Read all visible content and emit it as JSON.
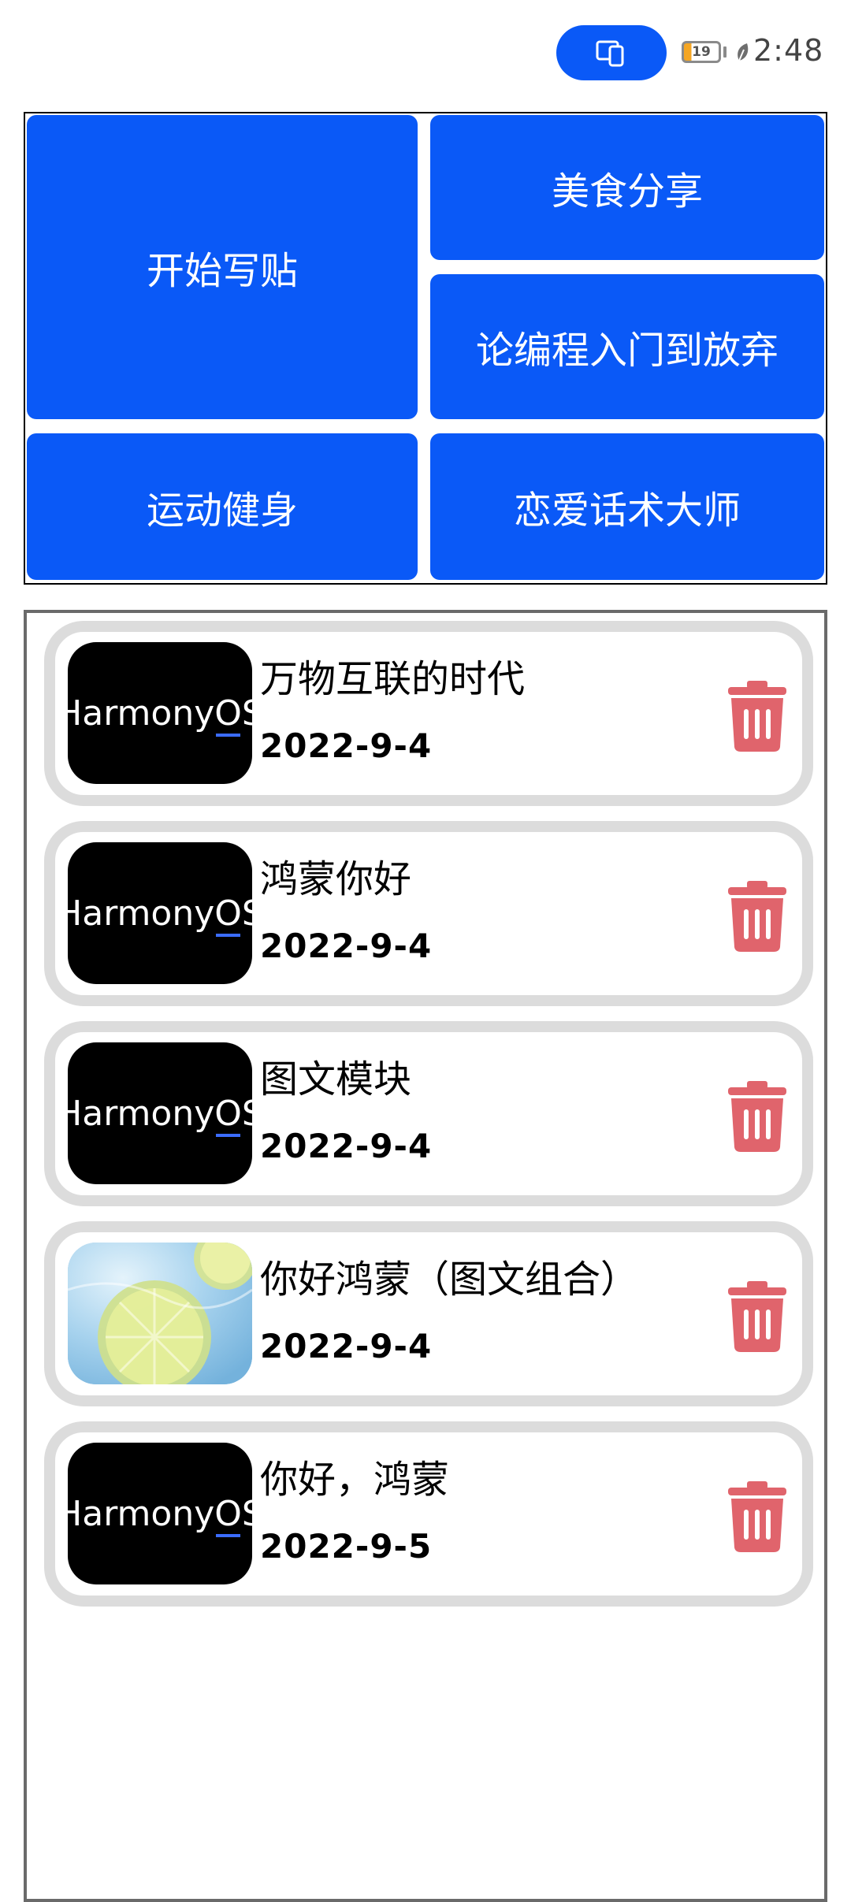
{
  "status_bar": {
    "battery_level": "19",
    "time": "2:48",
    "cast_icon": "multi-device-icon",
    "power_icon": "leaf-icon"
  },
  "grid": {
    "tiles": [
      {
        "label": "开始写贴"
      },
      {
        "label": "美食分享"
      },
      {
        "label": "论编程入门到放弃"
      },
      {
        "label": "运动健身"
      },
      {
        "label": "恋爱话术大师"
      }
    ]
  },
  "list": {
    "items": [
      {
        "title": "万物互联的时代",
        "date": "2022-9-4",
        "thumb": "HarmonyOS"
      },
      {
        "title": "鸿蒙你好",
        "date": "2022-9-4",
        "thumb": "HarmonyOS"
      },
      {
        "title": "图文模块",
        "date": "2022-9-4",
        "thumb": "HarmonyOS"
      },
      {
        "title": "你好鸿蒙（图文组合）",
        "date": "2022-9-4",
        "thumb": "lemon-photo"
      },
      {
        "title": "你好，鸿蒙",
        "date": "2022-9-5",
        "thumb": "HarmonyOS"
      }
    ],
    "delete_icon": "trash-icon"
  },
  "colors": {
    "accent": "#0a59f7",
    "delete": "#e0646c",
    "card_border": "#dcdcdc"
  }
}
